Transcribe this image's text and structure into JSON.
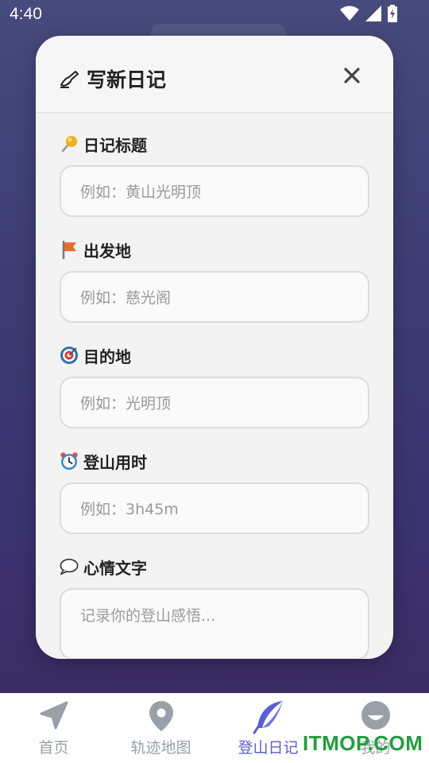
{
  "status_bar": {
    "time": "4:40"
  },
  "modal": {
    "title": "写新日记",
    "fields": [
      {
        "label": "日记标题",
        "icon": "pushpin-icon",
        "placeholder": "例如：黄山光明顶"
      },
      {
        "label": "出发地",
        "icon": "flag-icon",
        "placeholder": "例如：慈光阁"
      },
      {
        "label": "目的地",
        "icon": "target-icon",
        "placeholder": "例如：光明顶"
      },
      {
        "label": "登山用时",
        "icon": "alarm-clock-icon",
        "placeholder": "例如：3h45m"
      },
      {
        "label": "心情文字",
        "icon": "speech-bubble-icon",
        "placeholder": "记录你的登山感悟..."
      }
    ]
  },
  "bottom_nav": {
    "items": [
      {
        "label": "首页",
        "icon": "navigation-arrow-icon"
      },
      {
        "label": "轨迹地图",
        "icon": "map-pin-icon"
      },
      {
        "label": "登山日记",
        "icon": "feather-icon",
        "active": true
      },
      {
        "label": "我的",
        "icon": "profile-icon"
      }
    ],
    "active_color": "#5a5fd6",
    "inactive_color": "#9aa0a8"
  },
  "watermark": {
    "text_a": "ITMOP",
    "text_b": ".COM"
  }
}
